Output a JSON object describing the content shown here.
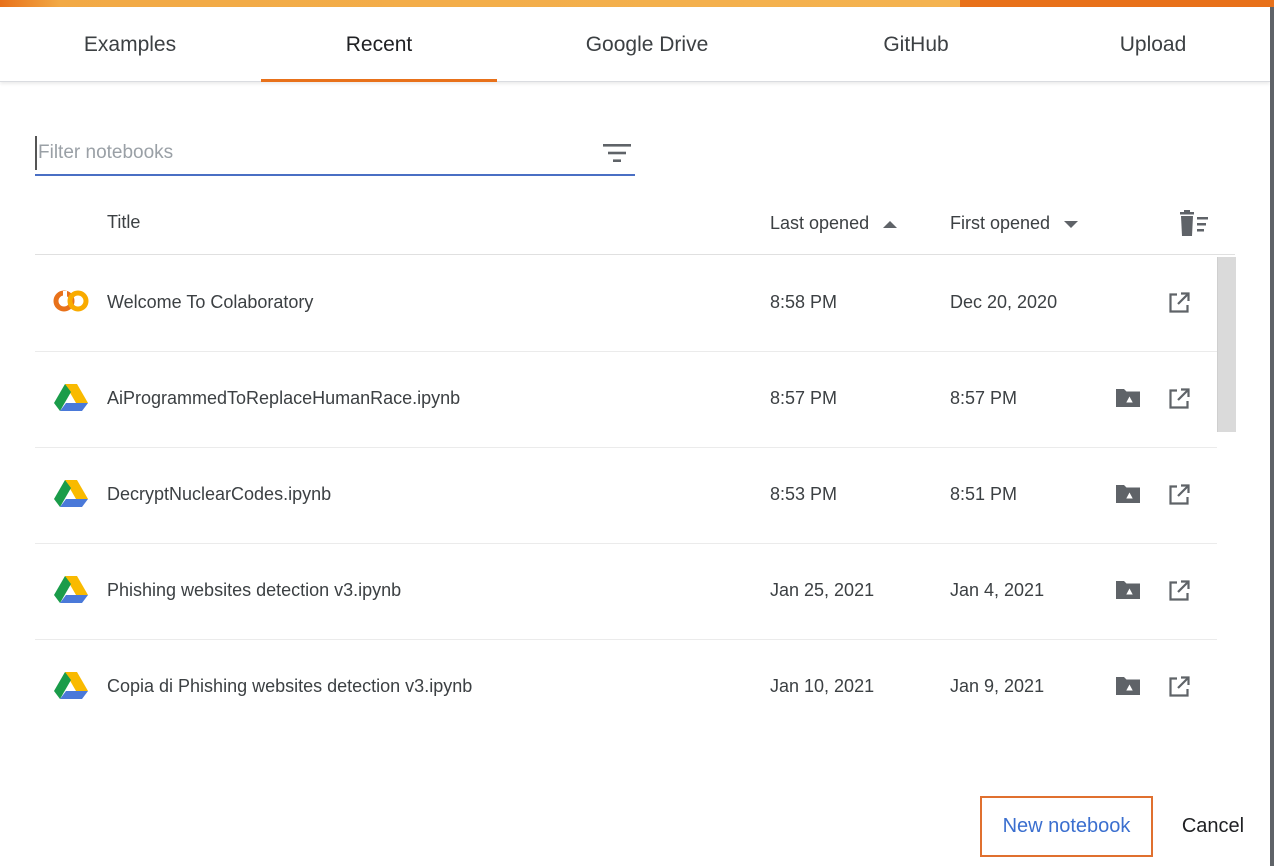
{
  "tabs": [
    {
      "label": "Examples",
      "active": false
    },
    {
      "label": "Recent",
      "active": true
    },
    {
      "label": "Google Drive",
      "active": false
    },
    {
      "label": "GitHub",
      "active": false
    },
    {
      "label": "Upload",
      "active": false
    }
  ],
  "filter": {
    "placeholder": "Filter notebooks",
    "value": "",
    "icon": "filter-list-icon"
  },
  "columns": {
    "title": "Title",
    "last_opened": "Last opened",
    "last_opened_sort": "ascending",
    "first_opened": "First opened",
    "first_opened_sort": "descending",
    "clear_icon": "delete-sweep-icon"
  },
  "notebooks": [
    {
      "icon": "colab-logo-icon",
      "title": "Welcome To Colaboratory",
      "last_opened": "8:58 PM",
      "first_opened": "Dec 20, 2020",
      "has_drive_folder": false
    },
    {
      "icon": "google-drive-icon",
      "title": "AiProgrammedToReplaceHumanRace.ipynb",
      "last_opened": "8:57 PM",
      "first_opened": "8:57 PM",
      "has_drive_folder": true
    },
    {
      "icon": "google-drive-icon",
      "title": "DecryptNuclearCodes.ipynb",
      "last_opened": "8:53 PM",
      "first_opened": "8:51 PM",
      "has_drive_folder": true
    },
    {
      "icon": "google-drive-icon",
      "title": "Phishing websites detection v3.ipynb",
      "last_opened": "Jan 25, 2021",
      "first_opened": "Jan 4, 2021",
      "has_drive_folder": true
    },
    {
      "icon": "google-drive-icon",
      "title": "Copia di Phishing websites detection v3.ipynb",
      "last_opened": "Jan 10, 2021",
      "first_opened": "Jan 9, 2021",
      "has_drive_folder": true
    }
  ],
  "footer": {
    "new_notebook_label": "New notebook",
    "cancel_label": "Cancel"
  },
  "colors": {
    "accent_orange": "#e8711a",
    "link_blue": "#3b6fcf",
    "input_underline": "#4a6fc4"
  }
}
